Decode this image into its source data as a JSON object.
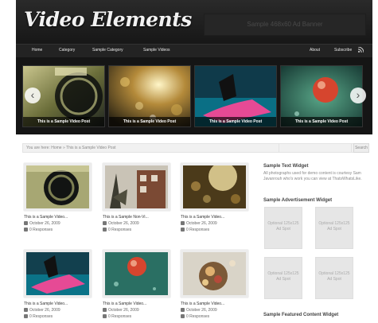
{
  "header": {
    "logo": "Video Elements",
    "box_text": "Sample 468x60 Ad Banner"
  },
  "nav": {
    "left": [
      "Home",
      "Category",
      "Sample Category",
      "Sample Videos"
    ],
    "right": [
      "About",
      "Subscribe"
    ]
  },
  "slider": {
    "caption": "This is a Sample Video Post",
    "prev_arrow": "‹",
    "next_arrow": "›"
  },
  "breadcrumb": "You are here: Home » This is a Sample Video Post",
  "search": {
    "button": "Search"
  },
  "posts": [
    {
      "title": "This is a Sample Video...",
      "date": "October 26, 2009",
      "responses": "0 Responses"
    },
    {
      "title": "This is a Sample Non-Vi...",
      "date": "October 26, 2009",
      "responses": "0 Responses"
    },
    {
      "title": "This is a Sample Video...",
      "date": "October 26, 2009",
      "responses": "0 Responses"
    },
    {
      "title": "This is a Sample Video...",
      "date": "October 26, 2009",
      "responses": "0 Responses"
    },
    {
      "title": "This is a Sample Video...",
      "date": "October 26, 2009",
      "responses": "0 Responses"
    },
    {
      "title": "This is a Sample Video...",
      "date": "October 26, 2009",
      "responses": "0 Responses"
    }
  ],
  "sidebar": {
    "text_widget_title": "Sample Text Widget",
    "text_widget_body": "All photographs used for demo content is courtesy Sam Javanrouh who's work you can view at ThatsWhatsLike.",
    "ad_widget_title": "Sample Advertisement Widget",
    "ad_label": "Optional 125x125 Ad Spot",
    "featured_title": "Sample Featured Content Widget"
  },
  "colors": {
    "header": "#1f1f1f",
    "nav": "#232323",
    "slider": "#151515",
    "accent": "#e04a8a"
  }
}
